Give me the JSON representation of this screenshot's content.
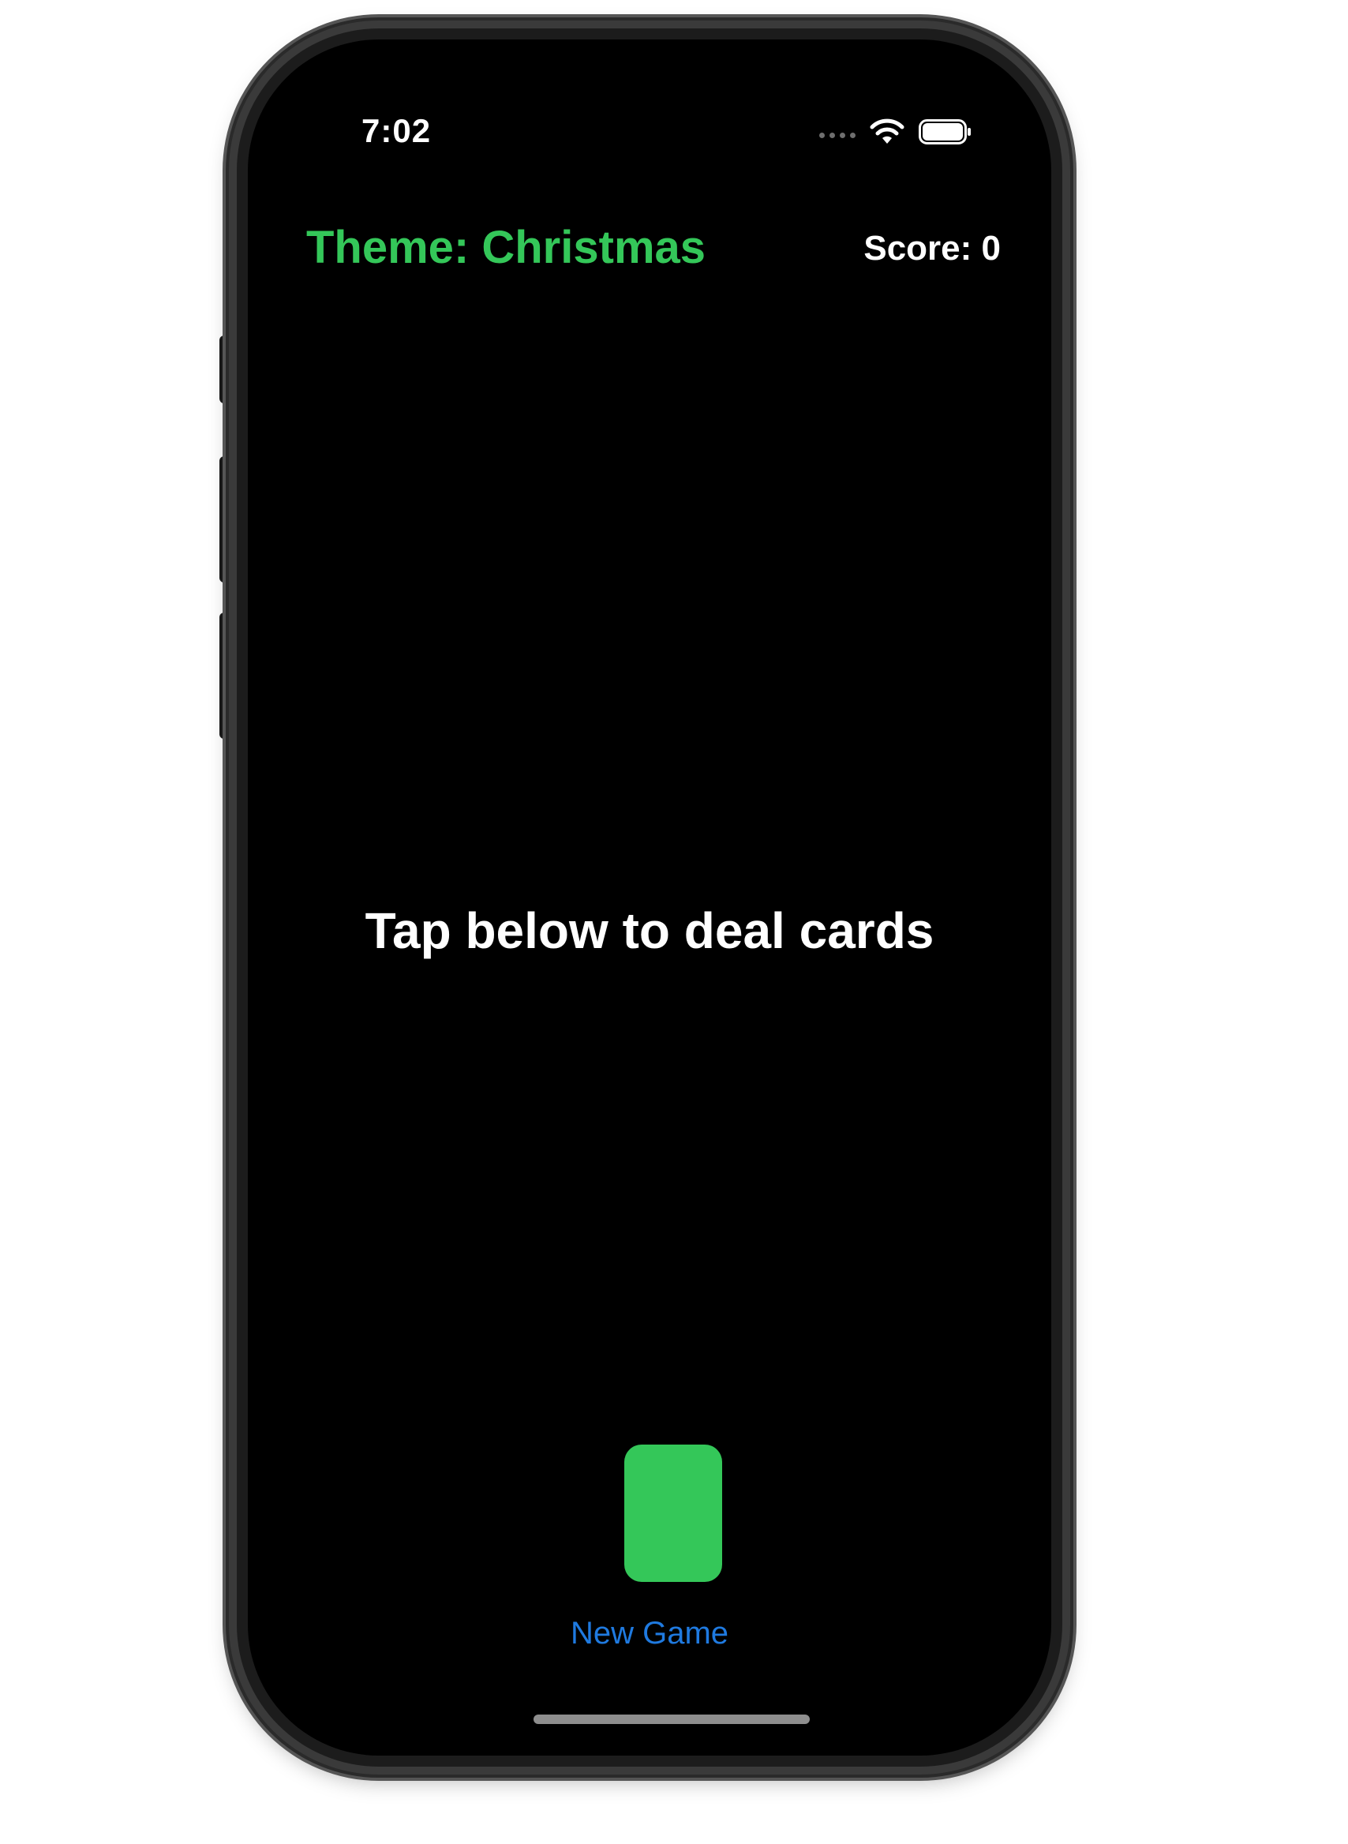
{
  "status_bar": {
    "time": "7:02",
    "icons": [
      "cellular-dots-icon",
      "wifi-icon",
      "battery-icon"
    ]
  },
  "header": {
    "theme_title": "Theme: Christmas",
    "score": "Score: 0"
  },
  "main": {
    "prompt": "Tap below to deal cards"
  },
  "footer": {
    "new_game_label": "New Game"
  },
  "colors": {
    "background": "#000000",
    "theme_accent": "#34c759",
    "link_blue": "#1f7ae0",
    "text": "#ffffff"
  }
}
